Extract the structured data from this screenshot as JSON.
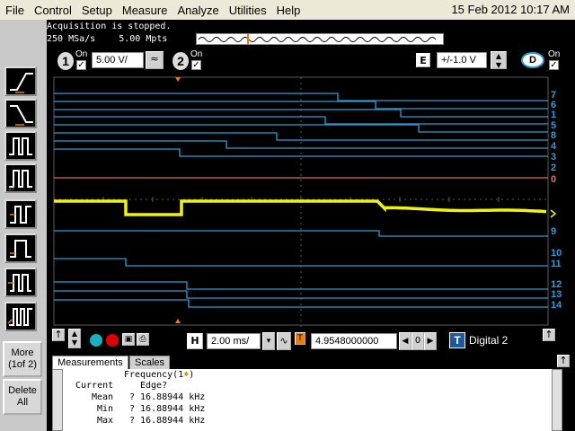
{
  "menu": {
    "items": [
      "File",
      "Control",
      "Setup",
      "Measure",
      "Analyze",
      "Utilities",
      "Help"
    ],
    "datetime": "15 Feb 2012 10:17 AM"
  },
  "status": {
    "acquisition": "Acquisition is stopped.",
    "sample_rate": "250 MSa/s",
    "memory_depth": "5.00 Mpts"
  },
  "channels": {
    "ch1": {
      "number": "1",
      "on_label": "On",
      "on": true,
      "scale": "5.00 V/"
    },
    "ch2": {
      "number": "2",
      "on_label": "On",
      "on": true
    },
    "digital": {
      "on_label": "On",
      "on": true,
      "trigger_level_label": "E",
      "trigger_level": "+/-1.0 V"
    }
  },
  "digital_labels": [
    "7",
    "6",
    "1",
    "5",
    "8",
    "4",
    "3",
    "2",
    "0",
    "9",
    "10",
    "11",
    "12",
    "13",
    "14"
  ],
  "horizontal": {
    "label": "H",
    "timebase": "2.00 ms/",
    "delay_label": "T",
    "delay": "4.9548000000 ms",
    "source_label": "T",
    "source": "Digital 2"
  },
  "side": {
    "more": "More",
    "page": "(1of 2)",
    "delete": "Delete",
    "all": "All"
  },
  "measurements": {
    "tabs": [
      "Measurements",
      "Scales"
    ],
    "header_name": "Frequency(1",
    "header_suffix": ")",
    "header_mark": "♦",
    "sub_header": "Edge?",
    "rows": [
      {
        "label": "Current",
        "value": ""
      },
      {
        "label": "Mean",
        "value": "? 16.88944 kHz"
      },
      {
        "label": "Min",
        "value": "? 16.88944 kHz"
      },
      {
        "label": "Max",
        "value": "? 16.88944 kHz"
      }
    ]
  },
  "colors": {
    "digital": "#2e9bd6",
    "analog": "#f2f20a",
    "d0": "#d9705c",
    "grid": "#5a5a5a",
    "trigger_marker": "#f07d00"
  }
}
